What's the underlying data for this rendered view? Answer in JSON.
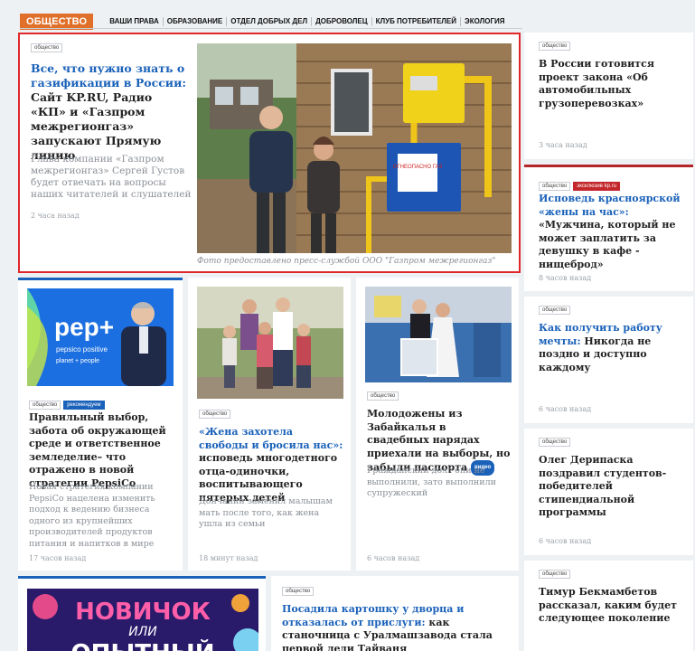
{
  "nav": {
    "brand": "ОБЩЕСТВО",
    "links": [
      "ВАШИ ПРАВА",
      "ОБРАЗОВАНИЕ",
      "ОТДЕЛ ДОБРЫХ ДЕЛ",
      "ДОБРОВОЛЕЦ",
      "КЛУБ ПОТРЕБИТЕЛЕЙ",
      "ЭКОЛОГИЯ"
    ]
  },
  "featured": {
    "tag": "общество",
    "lead": "Все, что нужно знать о газификации в России:",
    "rest": " Сайт KP.RU, Радио «КП» и «Газпром межрегионгаз» запускают Прямую линию",
    "desc": "Глава компании «Газпром межрегионгаз» Сергей Густов будет отвечать на вопросы наших читателей и слушателей",
    "time": "2 часа назад",
    "caption": "Фото предоставлено пресс-службой ООО \"Газпром межрегионгаз\"",
    "sign_text": "ОГНЕОПАСНО ГАЗ"
  },
  "middle": [
    {
      "tags": [
        "общество",
        "рекомендуем"
      ],
      "title": "Правильный выбор, забота об окружающей среде и ответственное земледелие– что отражено в новой стратегии PepsiCo",
      "desc": "Новая стратегия компании PepsiCo нацелена изменить подход к ведению бизнеса одного из крупнейших производителей продуктов питания и напитков в мире",
      "time": "17 часов назад",
      "logo": "pep+",
      "logo_sub": "pepsico positive",
      "logo_sub2": "planet + people"
    },
    {
      "tags": [
        "общество"
      ],
      "lead": "«Жена захотела свободы и бросила нас»:",
      "rest": " исповедь многодетного отца-одиночки, воспитывающего пятерых детей",
      "desc": "Дончанин заменил малышам мать после того, как жена ушла из семьи",
      "time": "18 минут назад"
    },
    {
      "tags": [
        "общество"
      ],
      "title": "Молодожены из Забайкалья в свадебных нарядах приехали на выборы, но забыли паспорта",
      "badge": "видео",
      "desc": "Гражданский долг они не выполнили, зато выполнили супружеский",
      "time": "6 часов назад"
    }
  ],
  "right": [
    {
      "tags": [
        "общество"
      ],
      "title": "В России готовится проект закона «Об автомобильных грузоперевозках»",
      "time": "3 часа назад"
    },
    {
      "tags": [
        "общество",
        "эксклюзив kp.ru"
      ],
      "lead": "Исповедь красноярской «жены на час»:",
      "rest": " «Мужчина, который не может заплатить за девушку в кафе - нищеброд»",
      "time": "8 часов назад"
    },
    {
      "tags": [
        "общество"
      ],
      "lead": "Как получить работу мечты:",
      "rest": " Никогда не поздно и доступно каждому",
      "time": "6 часов назад"
    },
    {
      "tags": [
        "общество"
      ],
      "title": "Олег Дерипаска поздравил студентов-победителей стипендиальной программы",
      "time": "6 часов назад"
    },
    {
      "tags": [
        "общество"
      ],
      "title": "Тимур Бекмамбетов рассказал, каким будет следующее поколение"
    }
  ],
  "bottom": {
    "promo_line1": "НОВИЧОК",
    "promo_line2": "ИЛИ",
    "promo_line3": "ОПЫТНЫЙ",
    "tag": "общество",
    "lead": "Посадила картошку у дворца и отказалась от прислуги:",
    "rest": " как станочница с Уралмашзавода стала первой леди Тайваня"
  },
  "colors": {
    "accent": "#1a61b9",
    "brand": "#e06f2a",
    "highlight": "#e0272a"
  }
}
